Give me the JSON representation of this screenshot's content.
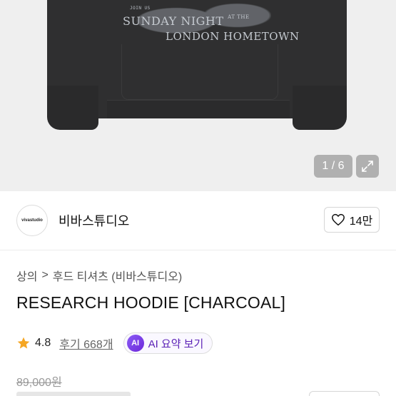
{
  "hero": {
    "print_small": "JOIN US",
    "print_line1": "SUNDAY NIGHT",
    "print_line1_sup": "AT THE",
    "print_line2": "LONDON HOMETOWN",
    "counter": "1 / 6"
  },
  "brand": {
    "logo_text": "vivastudio",
    "name": "비바스튜디오",
    "like_count": "14만"
  },
  "breadcrumb": [
    "상의",
    "후드 티셔츠 (비바스튜디오)"
  ],
  "breadcrumb_sep": ">",
  "product": {
    "title": "RESEARCH HOODIE [CHARCOAL]",
    "rating": "4.8",
    "reviews": "후기 668개",
    "ai_badge": "AI",
    "ai_label": "AI 요약 보기",
    "original_price": "89,000원"
  },
  "colors": {
    "star": "#f5a623",
    "ai": "#7c3aed",
    "heart": "#111111"
  }
}
